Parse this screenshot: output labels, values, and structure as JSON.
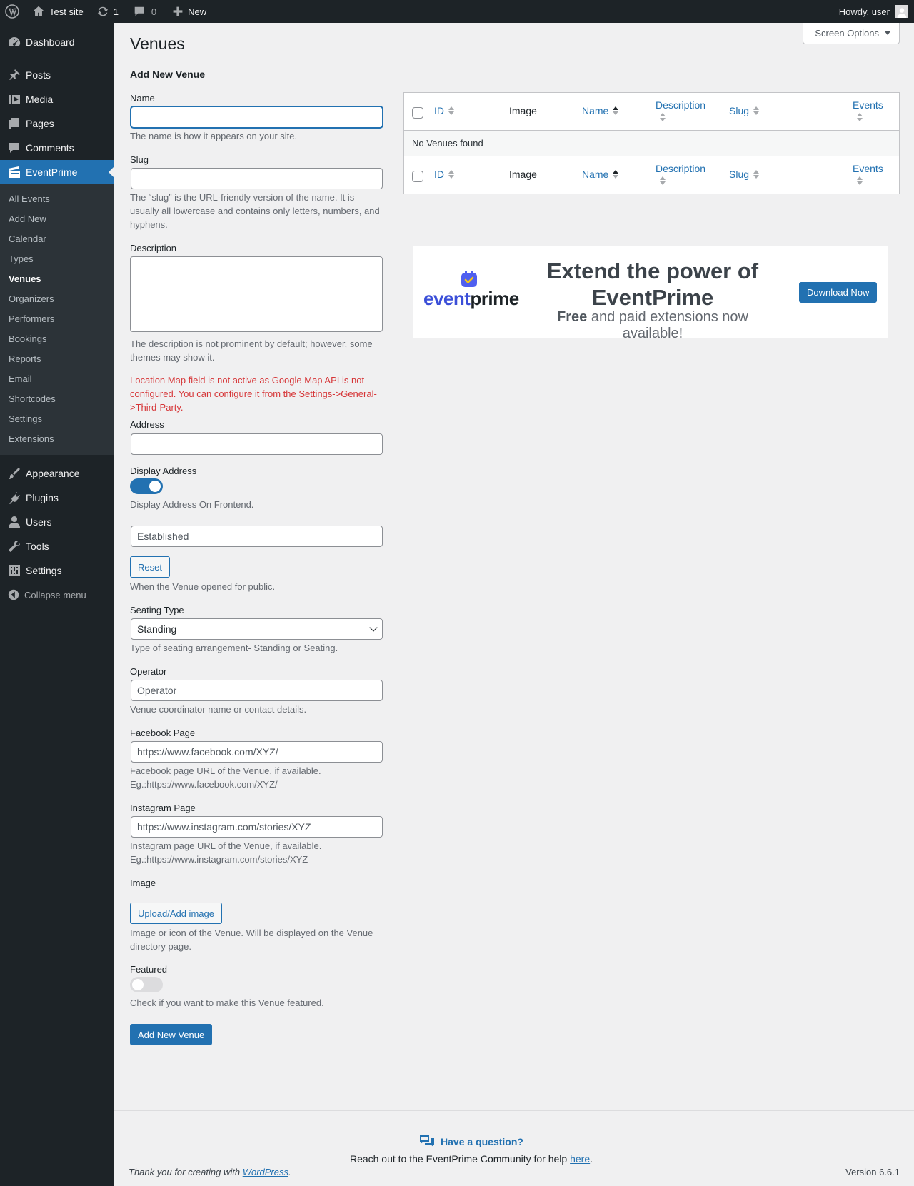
{
  "adminbar": {
    "site_name": "Test site",
    "updates_count": "1",
    "comments_count": "0",
    "new_label": "New",
    "howdy": "Howdy, user"
  },
  "sidebar": {
    "top_items": [
      {
        "label": "Dashboard",
        "icon": "dashboard-icon"
      },
      {
        "label": "Posts",
        "icon": "pin-icon"
      },
      {
        "label": "Media",
        "icon": "media-icon"
      },
      {
        "label": "Pages",
        "icon": "pages-icon"
      },
      {
        "label": "Comments",
        "icon": "comment-icon"
      },
      {
        "label": "EventPrime",
        "icon": "eventprime-icon"
      }
    ],
    "sub_items": [
      "All Events",
      "Add New",
      "Calendar",
      "Types",
      "Venues",
      "Organizers",
      "Performers",
      "Bookings",
      "Reports",
      "Email",
      "Shortcodes",
      "Settings",
      "Extensions"
    ],
    "bottom_items": [
      {
        "label": "Appearance",
        "icon": "brush-icon"
      },
      {
        "label": "Plugins",
        "icon": "plugin-icon"
      },
      {
        "label": "Users",
        "icon": "users-icon"
      },
      {
        "label": "Tools",
        "icon": "wrench-icon"
      },
      {
        "label": "Settings",
        "icon": "settings-icon"
      }
    ],
    "collapse_label": "Collapse menu"
  },
  "screen_options": "Screen Options",
  "page": {
    "title": "Venues",
    "form_title": "Add New Venue"
  },
  "form": {
    "name_label": "Name",
    "name_desc": "The name is how it appears on your site.",
    "slug_label": "Slug",
    "slug_desc": "The “slug” is the URL-friendly version of the name. It is usually all lowercase and contains only letters, numbers, and hyphens.",
    "description_label": "Description",
    "description_desc": "The description is not prominent by default; however, some themes may show it.",
    "map_error": "Location Map field is not active as Google Map API is not configured. You can configure it from the Settings->General->Third-Party.",
    "address_label": "Address",
    "display_address_label": "Display Address",
    "display_address_desc": "Display Address On Frontend.",
    "established_placeholder": "Established",
    "reset_label": "Reset",
    "established_desc": "When the Venue opened for public.",
    "seating_label": "Seating Type",
    "seating_value": "Standing",
    "seating_desc": "Type of seating arrangement- Standing or Seating.",
    "operator_label": "Operator",
    "operator_placeholder": "Operator",
    "operator_desc": "Venue coordinator name or contact details.",
    "facebook_label": "Facebook Page",
    "facebook_placeholder": "https://www.facebook.com/XYZ/",
    "facebook_desc": "Facebook page URL of the Venue, if available. Eg.:https://www.facebook.com/XYZ/",
    "instagram_label": "Instagram Page",
    "instagram_placeholder": "https://www.instagram.com/stories/XYZ",
    "instagram_desc": "Instagram page URL of the Venue, if available. Eg.:https://www.instagram.com/stories/XYZ",
    "image_label": "Image",
    "upload_label": "Upload/Add image",
    "image_desc": "Image or icon of the Venue. Will be displayed on the Venue directory page.",
    "featured_label": "Featured",
    "featured_desc": "Check if you want to make this Venue featured.",
    "submit_label": "Add New Venue"
  },
  "table": {
    "columns": {
      "id": "ID",
      "image": "Image",
      "name": "Name",
      "description": "Description",
      "slug": "Slug",
      "events": "Events"
    },
    "empty": "No Venues found"
  },
  "banner": {
    "logo_event": "event",
    "logo_prime": "prime",
    "headline": "Extend the power of EventPrime",
    "sub_bold": "Free",
    "sub_rest": "and paid extensions now available!",
    "button": "Download Now"
  },
  "footer": {
    "question": "Have a question?",
    "reach_text": "Reach out to the EventPrime Community for help",
    "reach_link": "here",
    "thanks_text": "Thank you for creating with",
    "thanks_link": "WordPress",
    "version": "Version 6.6.1"
  },
  "colors": {
    "accent": "#2271b1",
    "sidebar": "#1d2327",
    "error": "#d63638"
  }
}
